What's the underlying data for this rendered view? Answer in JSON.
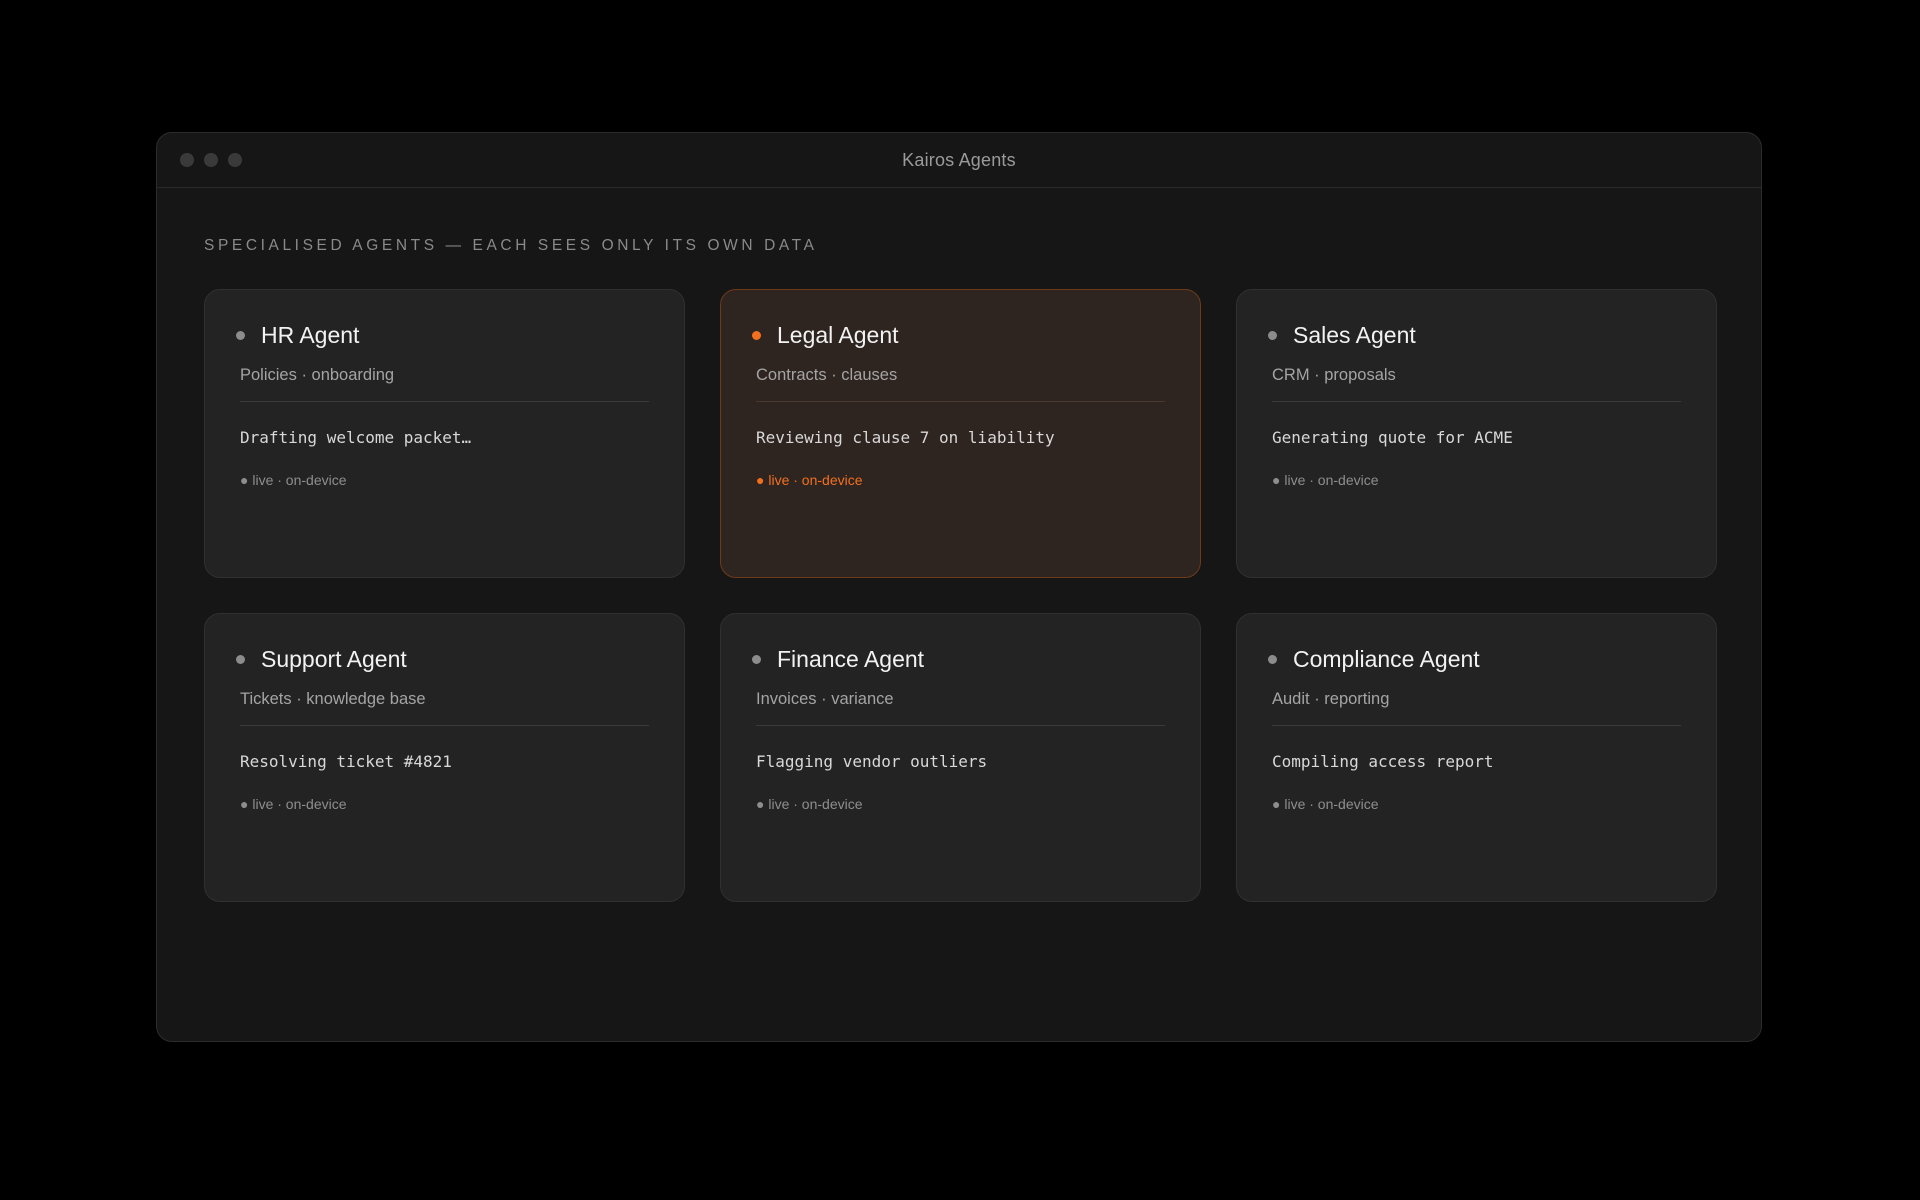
{
  "window": {
    "title": "Kairos Agents"
  },
  "section_label": "SPECIALISED AGENTS — EACH SEES ONLY ITS OWN DATA",
  "colors": {
    "accent": "#f2701e",
    "background": "#000000",
    "window_bg": "#161616",
    "card_bg": "#232323"
  },
  "agents": [
    {
      "name": "HR Agent",
      "subtitle": "Policies · onboarding",
      "task": "Drafting welcome packet…",
      "status": "● live · on-device",
      "active": false
    },
    {
      "name": "Legal Agent",
      "subtitle": "Contracts · clauses",
      "task": "Reviewing clause 7 on liability",
      "status": "● live · on-device",
      "active": true
    },
    {
      "name": "Sales Agent",
      "subtitle": "CRM · proposals",
      "task": "Generating quote for ACME",
      "status": "● live · on-device",
      "active": false
    },
    {
      "name": "Support Agent",
      "subtitle": "Tickets · knowledge base",
      "task": "Resolving ticket #4821",
      "status": "● live · on-device",
      "active": false
    },
    {
      "name": "Finance Agent",
      "subtitle": "Invoices · variance",
      "task": "Flagging vendor outliers",
      "status": "● live · on-device",
      "active": false
    },
    {
      "name": "Compliance Agent",
      "subtitle": "Audit · reporting",
      "task": "Compiling access report",
      "status": "● live · on-device",
      "active": false
    }
  ]
}
